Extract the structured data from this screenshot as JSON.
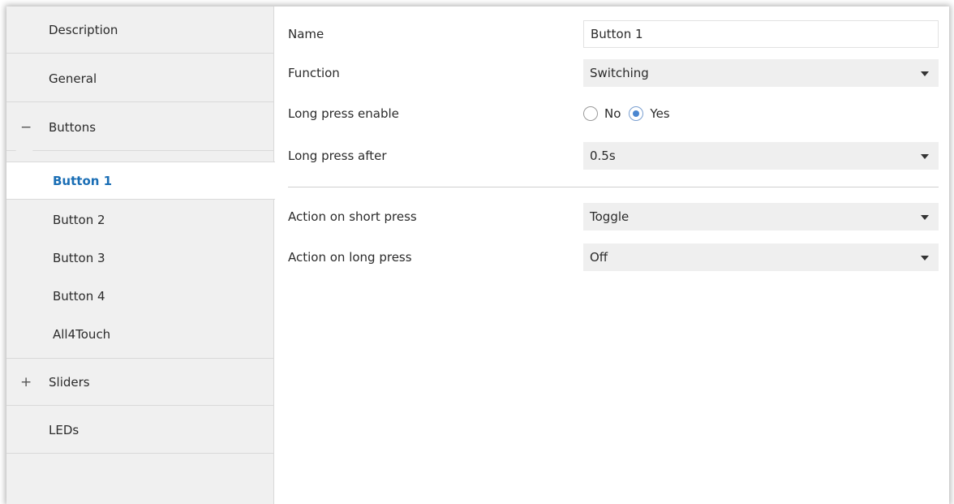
{
  "sidebar": {
    "sections": [
      {
        "label": "Description",
        "toggle": ""
      },
      {
        "label": "General",
        "toggle": ""
      },
      {
        "label": "Buttons",
        "toggle": "−"
      },
      {
        "label": "Sliders",
        "toggle": "+"
      },
      {
        "label": "LEDs",
        "toggle": ""
      }
    ],
    "sub_items": [
      "Button 1",
      "Button 2",
      "Button 3",
      "Button 4",
      "All4Touch"
    ],
    "active_item": "Button 1"
  },
  "form": {
    "name": {
      "label": "Name",
      "value": "Button 1"
    },
    "function": {
      "label": "Function",
      "value": "Switching"
    },
    "long_press_enable": {
      "label": "Long press enable",
      "options": [
        "No",
        "Yes"
      ],
      "selected": "Yes"
    },
    "long_press_after": {
      "label": "Long press after",
      "value": "0.5s"
    },
    "action_short": {
      "label": "Action on short press",
      "value": "Toggle"
    },
    "action_long": {
      "label": "Action on long press",
      "value": "Off"
    }
  },
  "colors": {
    "active_text": "#1a6eb5",
    "sidebar_bg": "#f0f0f0",
    "select_bg": "#efefef",
    "radio_dot": "#4a86d0"
  }
}
